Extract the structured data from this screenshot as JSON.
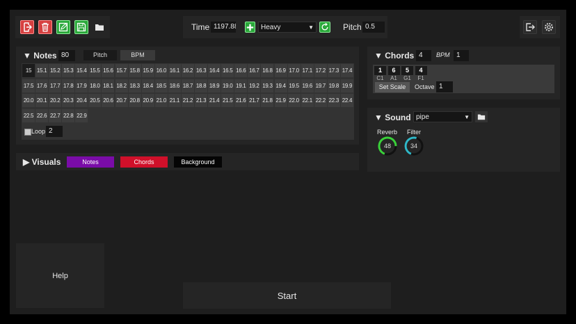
{
  "toolbar": {
    "icons": [
      "exit-file-icon",
      "trash-icon",
      "edit-icon",
      "save-icon",
      "folder-icon"
    ],
    "time_label": "Time",
    "time_value": "1197.88",
    "preset_selected": "Heavy",
    "pitch_label": "Pitch",
    "pitch_value": "0.5",
    "right_icons": [
      "logout-icon",
      "gear-icon"
    ]
  },
  "notes": {
    "title": "Notes",
    "count": "80",
    "tab_pitch": "Pitch",
    "tab_bpm": "BPM",
    "cells": [
      "15",
      "15.1",
      "15.2",
      "15.3",
      "15.4",
      "15.5",
      "15.6",
      "15.7",
      "15.8",
      "15.9",
      "16.0",
      "16.1",
      "16.2",
      "16.3",
      "16.4",
      "16.5",
      "16.6",
      "16.7",
      "16.8",
      "16.9",
      "17.0",
      "17.1",
      "17.2",
      "17.3",
      "17.4",
      "17.5",
      "17.6",
      "17.7",
      "17.8",
      "17.9",
      "18.0",
      "18.1",
      "18.2",
      "18.3",
      "18.4",
      "18.5",
      "18.6",
      "18.7",
      "18.8",
      "18.9",
      "19.0",
      "19.1",
      "19.2",
      "19.3",
      "19.4",
      "19.5",
      "19.6",
      "19.7",
      "19.8",
      "19.9",
      "20.0",
      "20.1",
      "20.2",
      "20.3",
      "20.4",
      "20.5",
      "20.6",
      "20.7",
      "20.8",
      "20.9",
      "21.0",
      "21.1",
      "21.2",
      "21.3",
      "21.4",
      "21.5",
      "21.6",
      "21.7",
      "21.8",
      "21.9",
      "22.0",
      "22.1",
      "22.2",
      "22.3",
      "22.4",
      "22.5",
      "22.6",
      "22.7",
      "22.8",
      "22.9"
    ],
    "loop_label": "Loop",
    "loop_value": "2"
  },
  "visuals": {
    "title": "Visuals",
    "notes_btn": "Notes",
    "chords_btn": "Chords",
    "background_btn": "Background",
    "colors": {
      "notes": "#7a0ca8",
      "chords": "#d0102a",
      "background": "#050505"
    }
  },
  "chords": {
    "title": "Chords",
    "count": "4",
    "bpm_label": "BPM",
    "bpm_value": "1",
    "items": [
      {
        "num": "1",
        "label": "C1"
      },
      {
        "num": "6",
        "label": "A1"
      },
      {
        "num": "5",
        "label": "G1"
      },
      {
        "num": "4",
        "label": "F1"
      }
    ],
    "set_scale": "Set Scale",
    "octave_label": "Octave",
    "octave_value": "1"
  },
  "sound": {
    "title": "Sound",
    "instrument": "pipe",
    "reverb_label": "Reverb",
    "reverb_value": "48",
    "reverb_level": 0.48,
    "filter_label": "Filter",
    "filter_value": "34",
    "filter_level": 0.34,
    "colors": {
      "reverb": "#3ad13a",
      "filter": "#2fb8c8"
    }
  },
  "help_label": "Help",
  "start_label": "Start"
}
